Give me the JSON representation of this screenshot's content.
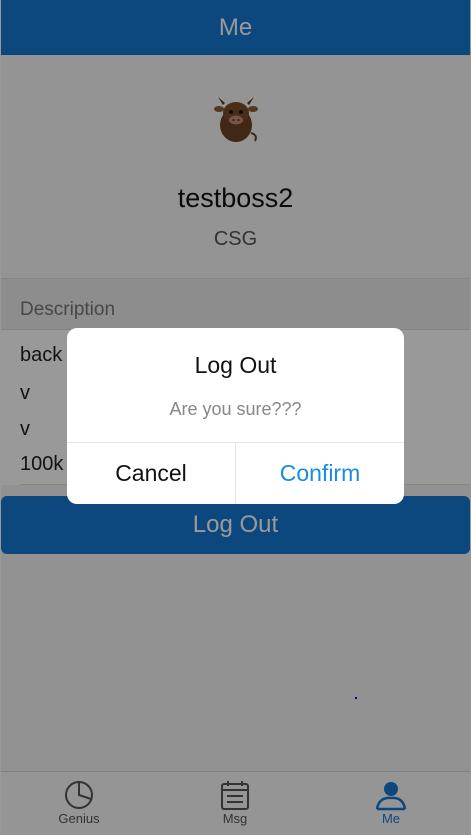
{
  "header": {
    "title": "Me"
  },
  "profile": {
    "username": "testboss2",
    "company": "CSG",
    "avatar_icon": "cow-avatar-icon"
  },
  "description": {
    "label": "Description",
    "items": [
      "back",
      "v",
      "v",
      "100k"
    ]
  },
  "logout_button": "Log Out",
  "tabs": [
    {
      "label": "Genius",
      "icon": "pie-chart-icon"
    },
    {
      "label": "Msg",
      "icon": "calendar-icon"
    },
    {
      "label": "Me",
      "icon": "person-icon",
      "active": true
    }
  ],
  "dialog": {
    "title": "Log Out",
    "message": "Are you sure???",
    "cancel": "Cancel",
    "confirm": "Confirm"
  },
  "colors": {
    "primary": "#1578d3",
    "confirm": "#1a8be0"
  }
}
